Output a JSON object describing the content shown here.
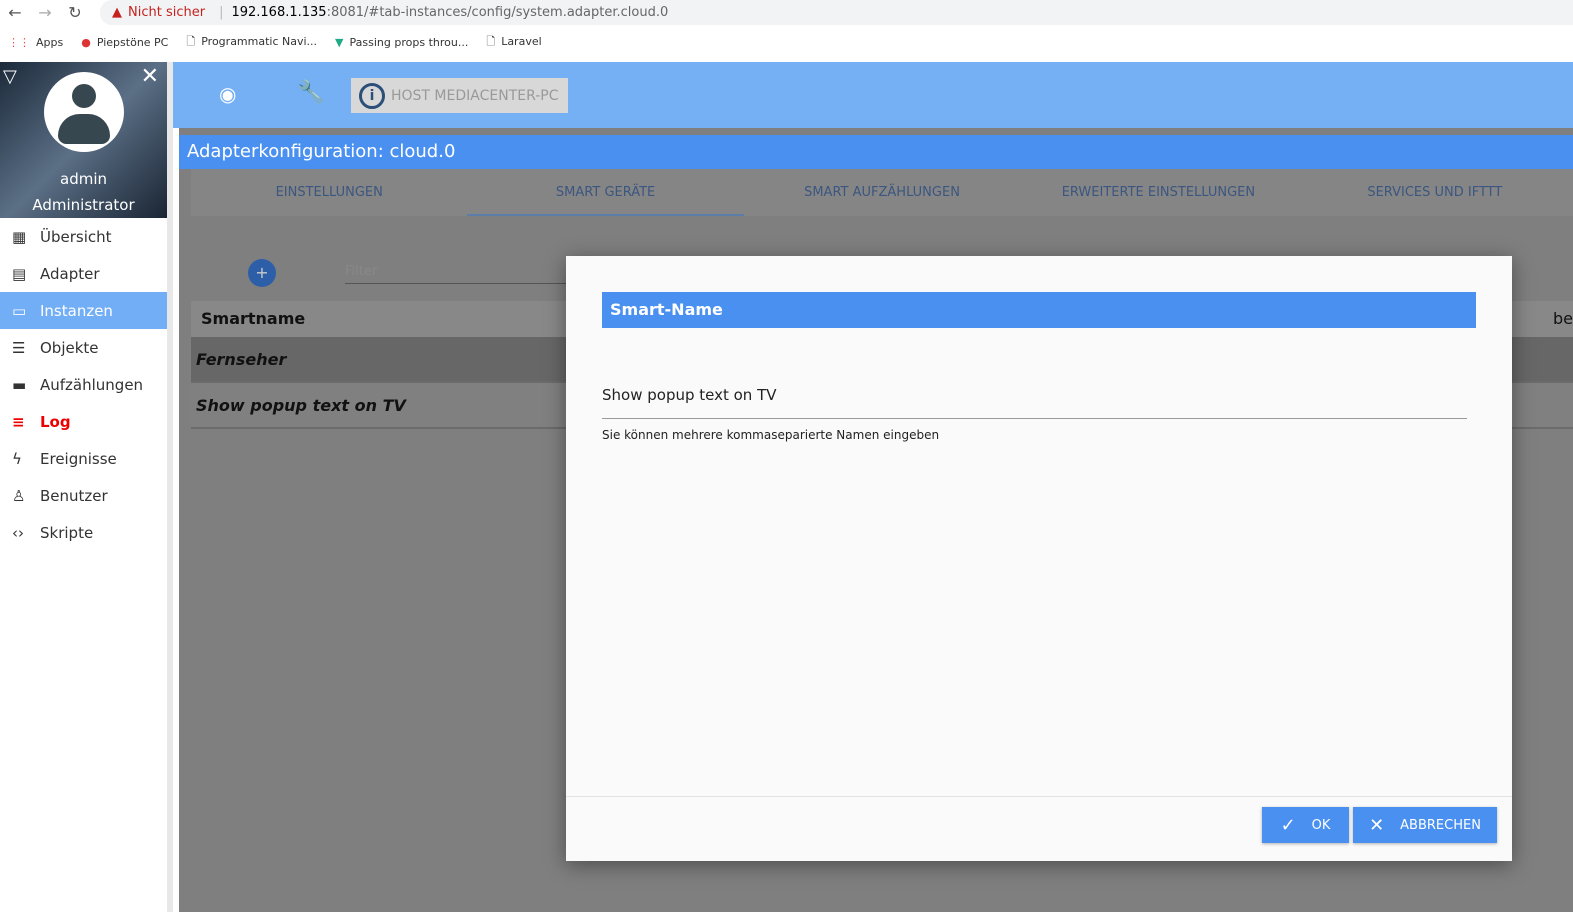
{
  "browser": {
    "security": "Nicht sicher",
    "url_host": "192.168.1.135",
    "url_rest": ":8081/#tab-instances/config/system.adapter.cloud.0",
    "bookmarks": [
      "Apps",
      "Piepstöne PC",
      "Programmatic Navi...",
      "Passing props throu...",
      "Laravel"
    ]
  },
  "profile": {
    "name": "admin",
    "role": "Administrator"
  },
  "sidebar": {
    "items": [
      {
        "label": "Übersicht",
        "icon": "grid-icon"
      },
      {
        "label": "Adapter",
        "icon": "store-icon"
      },
      {
        "label": "Instanzen",
        "icon": "instances-icon"
      },
      {
        "label": "Objekte",
        "icon": "list-icon"
      },
      {
        "label": "Aufzählungen",
        "icon": "enum-icon"
      },
      {
        "label": "Log",
        "icon": "log-icon"
      },
      {
        "label": "Ereignisse",
        "icon": "bolt-icon"
      },
      {
        "label": "Benutzer",
        "icon": "user-icon"
      },
      {
        "label": "Skripte",
        "icon": "code-icon"
      }
    ]
  },
  "toolbar": {
    "host": "HOST MEDIACENTER-PC"
  },
  "config": {
    "title": "Adapterkonfiguration: cloud.0",
    "tabs": [
      "EINSTELLUNGEN",
      "SMART GERÄTE",
      "SMART AUFZÄHLUNGEN",
      "ERWEITERTE EINSTELLUNGEN",
      "SERVICES UND IFTTT"
    ],
    "filter_placeholder": "Filter",
    "column": "Smartname",
    "column2": "be",
    "rows": [
      "Fernseher",
      "Show popup text on TV"
    ]
  },
  "dialog": {
    "title": "Smart-Name",
    "value": "Show popup text on TV",
    "help": "Sie können mehrere kommaseparierte Namen eingeben",
    "ok": "OK",
    "cancel": "ABBRECHEN"
  },
  "colors": {
    "accent": "#4a90f0",
    "header": "#75b0f5",
    "log": "#e00000"
  }
}
